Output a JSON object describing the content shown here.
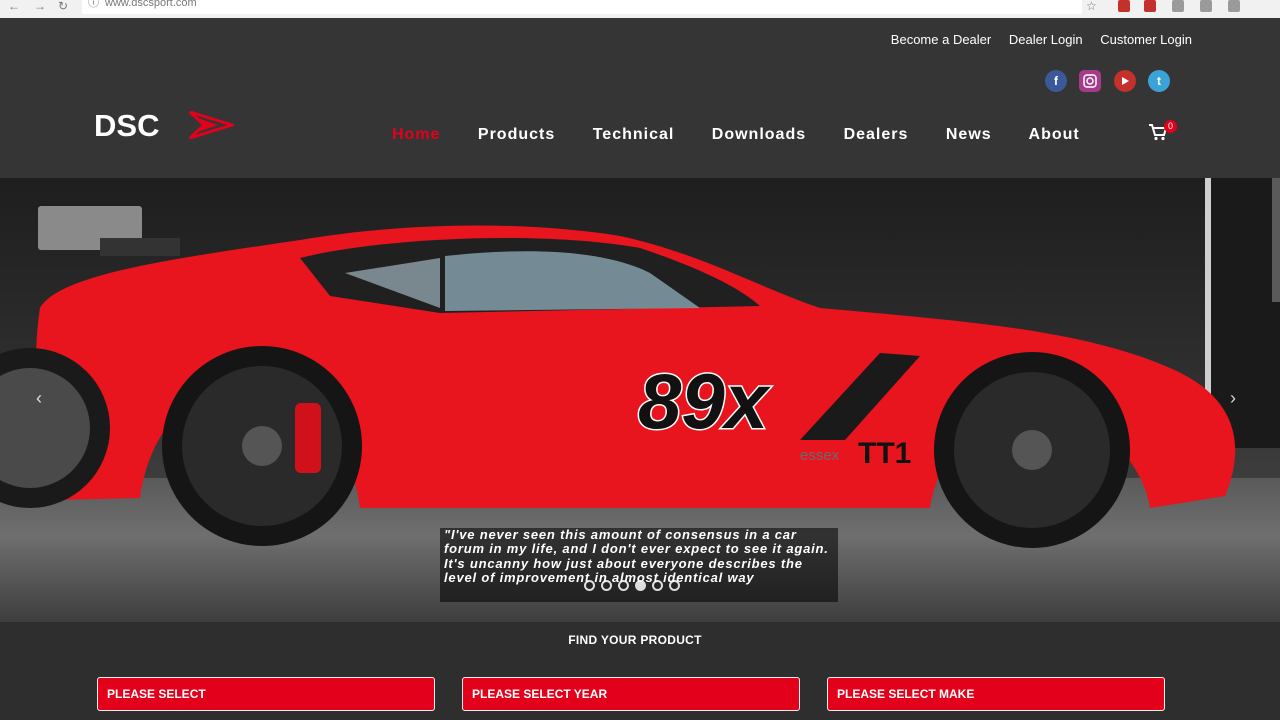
{
  "browser": {
    "url": "www.dscsport.com"
  },
  "header": {
    "top_links": [
      "Become a Dealer",
      "Dealer Login",
      "Customer Login"
    ],
    "social_icons": [
      "facebook-icon",
      "instagram-icon",
      "youtube-icon",
      "twitter-icon"
    ],
    "logo_text": "DSC",
    "nav": [
      "Home",
      "Products",
      "Technical",
      "Downloads",
      "Dealers",
      "News",
      "About"
    ],
    "active_nav": "Home",
    "cart_count": "0"
  },
  "hero": {
    "quote": "\"I've never seen this amount of consensus in a car forum in my life, and I don't ever expect to see it again. It's uncanny how just about everyone describes the level of improvement in almost identical way",
    "car_number": "89x",
    "car_badge": "TT1",
    "car_sponsor": "essex",
    "slides": 6,
    "active_slide": 3
  },
  "finder": {
    "title": "FIND YOUR PRODUCT",
    "selects": [
      "PLEASE SELECT",
      "PLEASE SELECT YEAR",
      "PLEASE SELECT MAKE"
    ]
  },
  "colors": {
    "accent": "#e3001b",
    "header_bg": "#353535",
    "page_bg": "#2e2e2e"
  }
}
